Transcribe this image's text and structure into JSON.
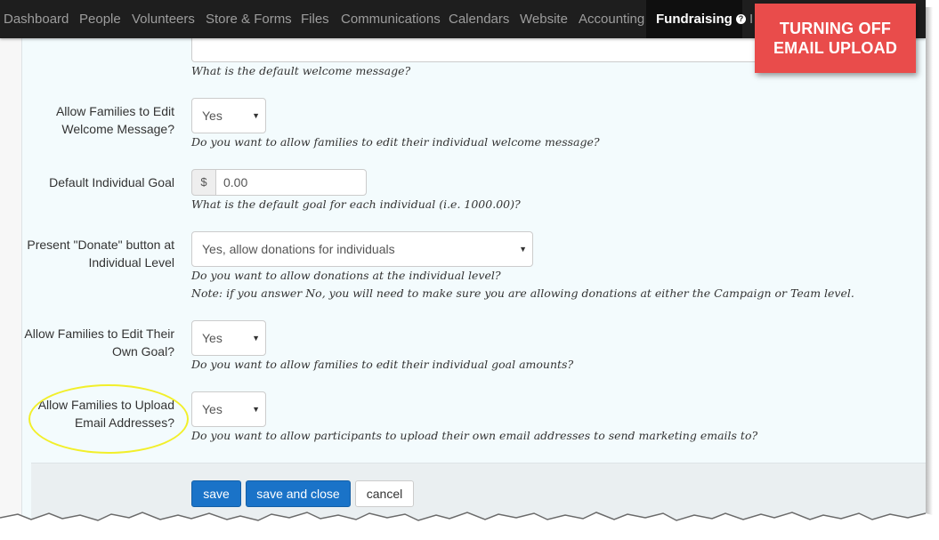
{
  "navbar": {
    "items": [
      "Dashboard",
      "People",
      "Volunteers",
      "Store & Forms",
      "Files",
      "Communications",
      "Calendars",
      "Website",
      "Accounting",
      "Fundraising"
    ],
    "active": "Fundraising",
    "more_partial": "I"
  },
  "banner": {
    "line1": "TURNING OFF",
    "line2": "EMAIL UPLOAD",
    "color": "#e94c4b"
  },
  "form": {
    "welcome_message": {
      "help": "What is the default welcome message?"
    },
    "edit_welcome": {
      "label": "Allow Families to Edit Welcome Message?",
      "value": "Yes",
      "help": "Do you want to allow families to edit their individual welcome message?"
    },
    "goal": {
      "label": "Default Individual Goal",
      "addon": "$",
      "value": "0.00",
      "help": "What is the default goal for each individual (i.e. 1000.00)?"
    },
    "donate": {
      "label": "Present \"Donate\" button at Individual Level",
      "value": "Yes, allow donations for individuals",
      "help": "Do you want to allow donations at the individual level?",
      "note": "Note: if you answer No, you will need to make sure you are allowing donations at either the Campaign or Team level."
    },
    "edit_goal": {
      "label": "Allow Families to Edit Their Own Goal?",
      "value": "Yes",
      "help": "Do you want to allow families to edit their individual goal amounts?"
    },
    "upload_email": {
      "label": "Allow Families to Upload Email Addresses?",
      "value": "Yes",
      "help": "Do you want to allow participants to upload their own email addresses to send marketing emails to?"
    }
  },
  "buttons": {
    "save": "save",
    "save_close": "save and close",
    "cancel": "cancel"
  },
  "colors": {
    "navbar_bg": "#1e1e1e",
    "primary_button": "#1a73c8",
    "highlight": "#f2ef2a",
    "content_bg": "#f3fbfd"
  }
}
